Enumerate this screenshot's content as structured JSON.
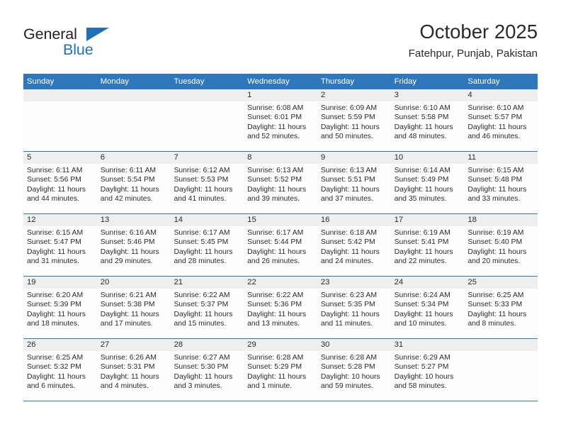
{
  "brand": {
    "name_part1": "General",
    "name_part2": "Blue",
    "triangle_icon": "triangle-icon",
    "primary_color": "#1f72b8"
  },
  "header": {
    "title": "October 2025",
    "subtitle": "Fatehpur, Punjab, Pakistan",
    "header_color": "#2e77bb"
  },
  "calendar": {
    "weekdays": [
      "Sunday",
      "Monday",
      "Tuesday",
      "Wednesday",
      "Thursday",
      "Friday",
      "Saturday"
    ],
    "weeks": [
      [
        {
          "day": "",
          "lines": []
        },
        {
          "day": "",
          "lines": []
        },
        {
          "day": "",
          "lines": []
        },
        {
          "day": "1",
          "lines": [
            "Sunrise: 6:08 AM",
            "Sunset: 6:01 PM",
            "Daylight: 11 hours",
            "and 52 minutes."
          ]
        },
        {
          "day": "2",
          "lines": [
            "Sunrise: 6:09 AM",
            "Sunset: 5:59 PM",
            "Daylight: 11 hours",
            "and 50 minutes."
          ]
        },
        {
          "day": "3",
          "lines": [
            "Sunrise: 6:10 AM",
            "Sunset: 5:58 PM",
            "Daylight: 11 hours",
            "and 48 minutes."
          ]
        },
        {
          "day": "4",
          "lines": [
            "Sunrise: 6:10 AM",
            "Sunset: 5:57 PM",
            "Daylight: 11 hours",
            "and 46 minutes."
          ]
        }
      ],
      [
        {
          "day": "5",
          "lines": [
            "Sunrise: 6:11 AM",
            "Sunset: 5:56 PM",
            "Daylight: 11 hours",
            "and 44 minutes."
          ]
        },
        {
          "day": "6",
          "lines": [
            "Sunrise: 6:11 AM",
            "Sunset: 5:54 PM",
            "Daylight: 11 hours",
            "and 42 minutes."
          ]
        },
        {
          "day": "7",
          "lines": [
            "Sunrise: 6:12 AM",
            "Sunset: 5:53 PM",
            "Daylight: 11 hours",
            "and 41 minutes."
          ]
        },
        {
          "day": "8",
          "lines": [
            "Sunrise: 6:13 AM",
            "Sunset: 5:52 PM",
            "Daylight: 11 hours",
            "and 39 minutes."
          ]
        },
        {
          "day": "9",
          "lines": [
            "Sunrise: 6:13 AM",
            "Sunset: 5:51 PM",
            "Daylight: 11 hours",
            "and 37 minutes."
          ]
        },
        {
          "day": "10",
          "lines": [
            "Sunrise: 6:14 AM",
            "Sunset: 5:49 PM",
            "Daylight: 11 hours",
            "and 35 minutes."
          ]
        },
        {
          "day": "11",
          "lines": [
            "Sunrise: 6:15 AM",
            "Sunset: 5:48 PM",
            "Daylight: 11 hours",
            "and 33 minutes."
          ]
        }
      ],
      [
        {
          "day": "12",
          "lines": [
            "Sunrise: 6:15 AM",
            "Sunset: 5:47 PM",
            "Daylight: 11 hours",
            "and 31 minutes."
          ]
        },
        {
          "day": "13",
          "lines": [
            "Sunrise: 6:16 AM",
            "Sunset: 5:46 PM",
            "Daylight: 11 hours",
            "and 29 minutes."
          ]
        },
        {
          "day": "14",
          "lines": [
            "Sunrise: 6:17 AM",
            "Sunset: 5:45 PM",
            "Daylight: 11 hours",
            "and 28 minutes."
          ]
        },
        {
          "day": "15",
          "lines": [
            "Sunrise: 6:17 AM",
            "Sunset: 5:44 PM",
            "Daylight: 11 hours",
            "and 26 minutes."
          ]
        },
        {
          "day": "16",
          "lines": [
            "Sunrise: 6:18 AM",
            "Sunset: 5:42 PM",
            "Daylight: 11 hours",
            "and 24 minutes."
          ]
        },
        {
          "day": "17",
          "lines": [
            "Sunrise: 6:19 AM",
            "Sunset: 5:41 PM",
            "Daylight: 11 hours",
            "and 22 minutes."
          ]
        },
        {
          "day": "18",
          "lines": [
            "Sunrise: 6:19 AM",
            "Sunset: 5:40 PM",
            "Daylight: 11 hours",
            "and 20 minutes."
          ]
        }
      ],
      [
        {
          "day": "19",
          "lines": [
            "Sunrise: 6:20 AM",
            "Sunset: 5:39 PM",
            "Daylight: 11 hours",
            "and 18 minutes."
          ]
        },
        {
          "day": "20",
          "lines": [
            "Sunrise: 6:21 AM",
            "Sunset: 5:38 PM",
            "Daylight: 11 hours",
            "and 17 minutes."
          ]
        },
        {
          "day": "21",
          "lines": [
            "Sunrise: 6:22 AM",
            "Sunset: 5:37 PM",
            "Daylight: 11 hours",
            "and 15 minutes."
          ]
        },
        {
          "day": "22",
          "lines": [
            "Sunrise: 6:22 AM",
            "Sunset: 5:36 PM",
            "Daylight: 11 hours",
            "and 13 minutes."
          ]
        },
        {
          "day": "23",
          "lines": [
            "Sunrise: 6:23 AM",
            "Sunset: 5:35 PM",
            "Daylight: 11 hours",
            "and 11 minutes."
          ]
        },
        {
          "day": "24",
          "lines": [
            "Sunrise: 6:24 AM",
            "Sunset: 5:34 PM",
            "Daylight: 11 hours",
            "and 10 minutes."
          ]
        },
        {
          "day": "25",
          "lines": [
            "Sunrise: 6:25 AM",
            "Sunset: 5:33 PM",
            "Daylight: 11 hours",
            "and 8 minutes."
          ]
        }
      ],
      [
        {
          "day": "26",
          "lines": [
            "Sunrise: 6:25 AM",
            "Sunset: 5:32 PM",
            "Daylight: 11 hours",
            "and 6 minutes."
          ]
        },
        {
          "day": "27",
          "lines": [
            "Sunrise: 6:26 AM",
            "Sunset: 5:31 PM",
            "Daylight: 11 hours",
            "and 4 minutes."
          ]
        },
        {
          "day": "28",
          "lines": [
            "Sunrise: 6:27 AM",
            "Sunset: 5:30 PM",
            "Daylight: 11 hours",
            "and 3 minutes."
          ]
        },
        {
          "day": "29",
          "lines": [
            "Sunrise: 6:28 AM",
            "Sunset: 5:29 PM",
            "Daylight: 11 hours",
            "and 1 minute."
          ]
        },
        {
          "day": "30",
          "lines": [
            "Sunrise: 6:28 AM",
            "Sunset: 5:28 PM",
            "Daylight: 10 hours",
            "and 59 minutes."
          ]
        },
        {
          "day": "31",
          "lines": [
            "Sunrise: 6:29 AM",
            "Sunset: 5:27 PM",
            "Daylight: 10 hours",
            "and 58 minutes."
          ]
        },
        {
          "day": "",
          "lines": []
        }
      ]
    ]
  }
}
